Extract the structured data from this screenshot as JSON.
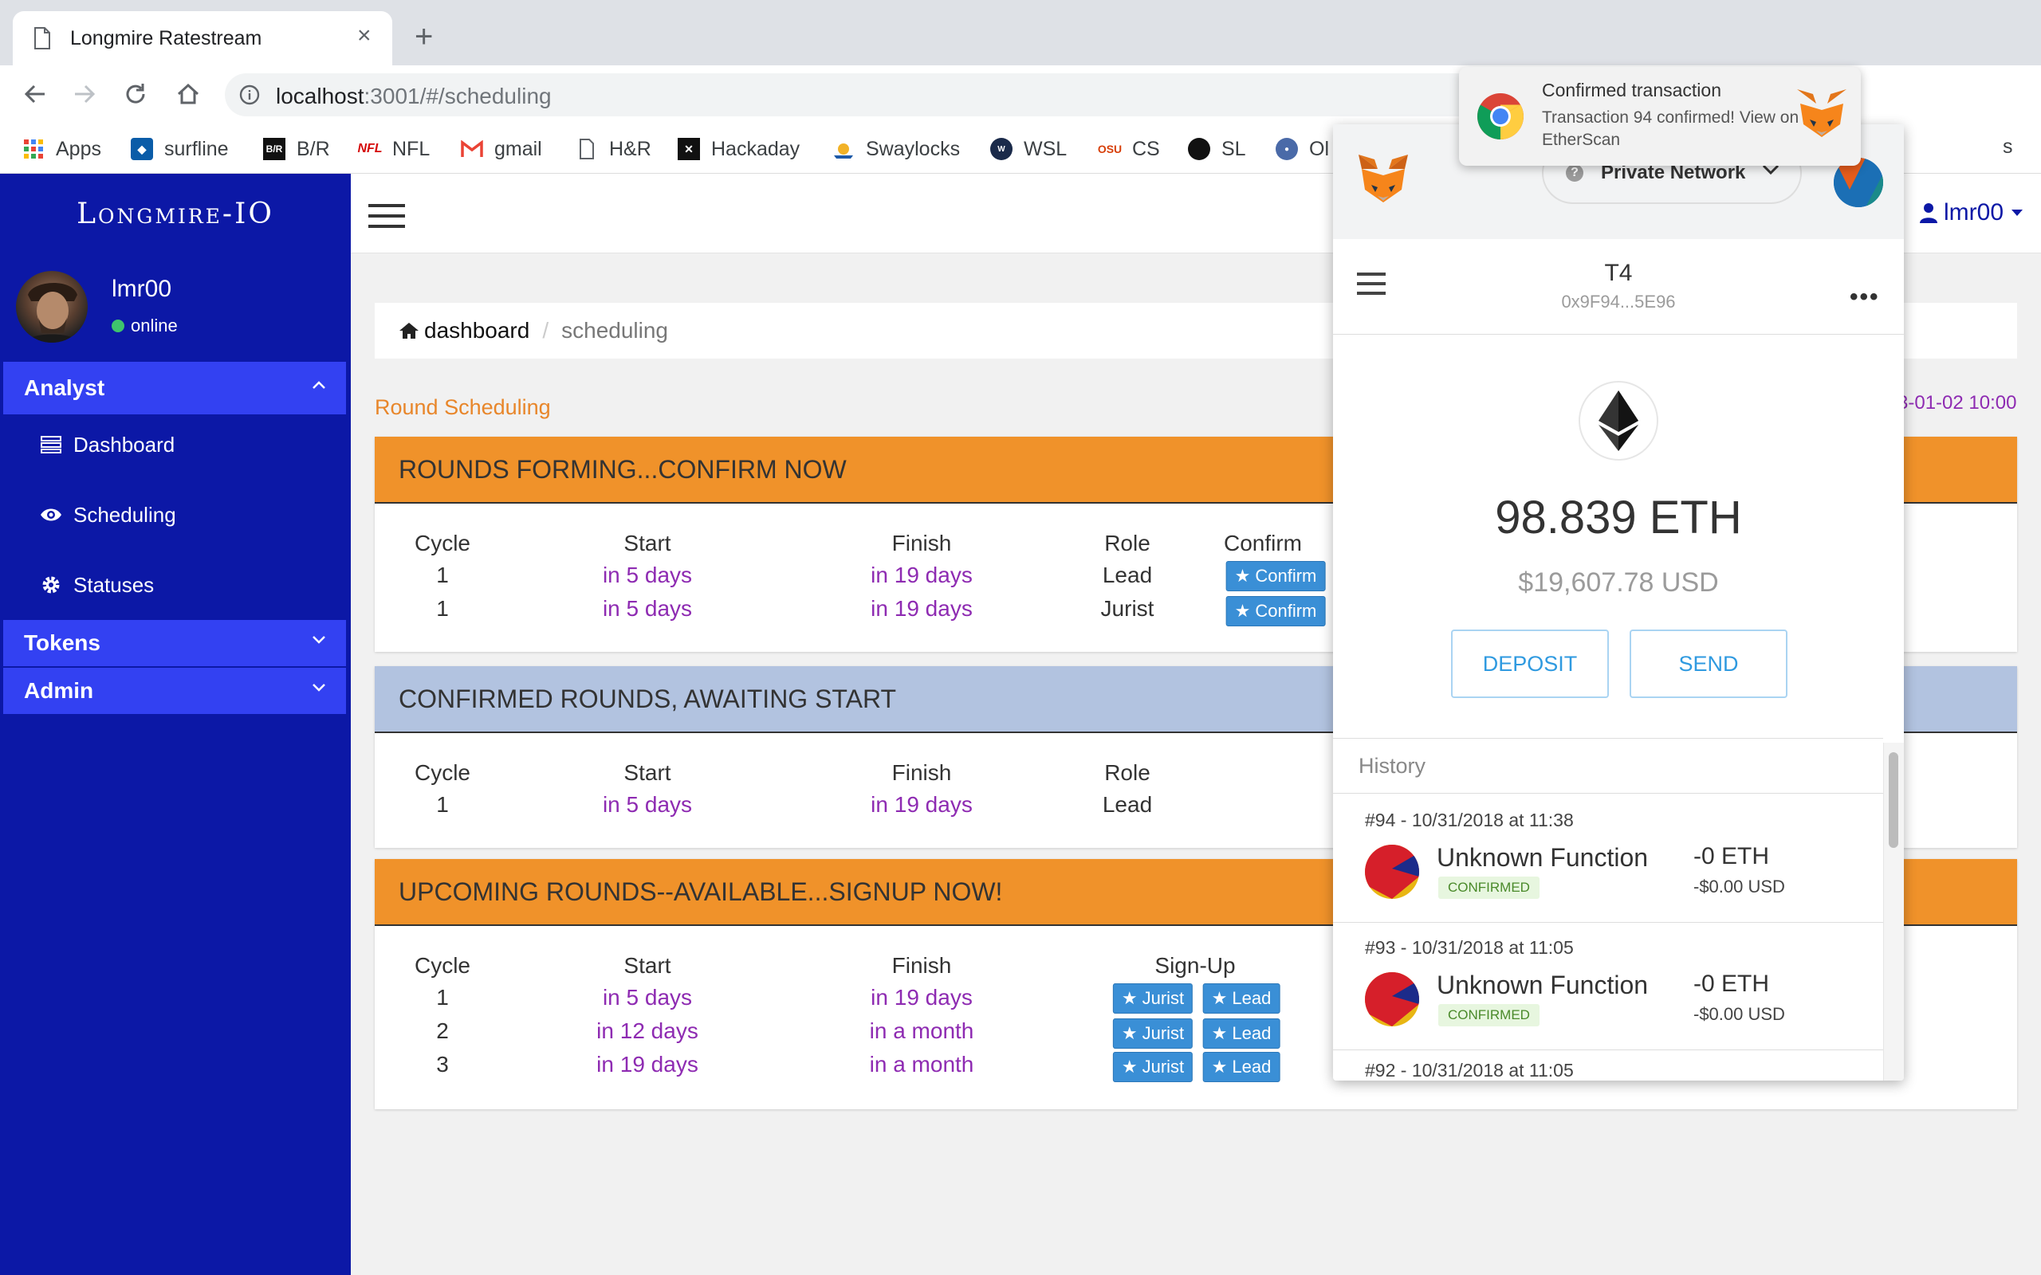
{
  "browser": {
    "tab_title": "Longmire Ratestream",
    "url_host": "localhost",
    "url_rest": ":3001/#/scheduling",
    "bookmarks": [
      {
        "label": "Apps"
      },
      {
        "label": "surfline"
      },
      {
        "label": "B/R"
      },
      {
        "label": "NFL"
      },
      {
        "label": "gmail"
      },
      {
        "label": "H&R"
      },
      {
        "label": "Hackaday"
      },
      {
        "label": "Swaylocks"
      },
      {
        "label": "WSL"
      },
      {
        "label": "CS"
      },
      {
        "label": "SL"
      },
      {
        "label": "Ol"
      }
    ],
    "bookmark_overflow": "s"
  },
  "sidebar": {
    "brand": "Longmire-IO",
    "user": "lmr00",
    "status": "online",
    "sections": [
      {
        "label": "Analyst",
        "items": [
          "Dashboard",
          "Scheduling",
          "Statuses"
        ]
      },
      {
        "label": "Tokens"
      },
      {
        "label": "Admin"
      }
    ]
  },
  "header": {
    "user": "lmr00"
  },
  "breadcrumb": {
    "home": "dashboard",
    "current": "scheduling"
  },
  "page": {
    "title": "Round Scheduling",
    "clock_partial": "3-01-02 10:00"
  },
  "panels": {
    "forming": {
      "title": "ROUNDS FORMING...CONFIRM NOW",
      "headers": [
        "Cycle",
        "Start",
        "Finish",
        "Role",
        "Confirm"
      ],
      "rows": [
        {
          "cycle": "1",
          "start": "in 5 days",
          "finish": "in 19 days",
          "role": "Lead",
          "action": "Confirm"
        },
        {
          "cycle": "1",
          "start": "in 5 days",
          "finish": "in 19 days",
          "role": "Jurist",
          "action": "Confirm"
        }
      ]
    },
    "confirmed": {
      "title": "CONFIRMED ROUNDS, AWAITING START",
      "headers": [
        "Cycle",
        "Start",
        "Finish",
        "Role"
      ],
      "rows": [
        {
          "cycle": "1",
          "start": "in 5 days",
          "finish": "in 19 days",
          "role": "Lead"
        }
      ]
    },
    "upcoming": {
      "title": "UPCOMING ROUNDS--AVAILABLE...SIGNUP NOW!",
      "headers": [
        "Cycle",
        "Start",
        "Finish",
        "Sign-Up"
      ],
      "rows": [
        {
          "cycle": "1",
          "start": "in 5 days",
          "finish": "in 19 days",
          "jurist": "Jurist",
          "lead": "Lead"
        },
        {
          "cycle": "2",
          "start": "in 12 days",
          "finish": "in a month",
          "jurist": "Jurist",
          "lead": "Lead"
        },
        {
          "cycle": "3",
          "start": "in 19 days",
          "finish": "in a month",
          "jurist": "Jurist",
          "lead": "Lead"
        }
      ]
    }
  },
  "metamask": {
    "network": "Private Network",
    "account_name": "T4",
    "account_address": "0x9F94...5E96",
    "balance_eth": "98.839 ETH",
    "balance_usd": "$19,607.78 USD",
    "deposit_label": "DEPOSIT",
    "send_label": "SEND",
    "history_label": "History",
    "transactions": [
      {
        "date": "#94 - 10/31/2018 at 11:38",
        "function": "Unknown Function",
        "status": "CONFIRMED",
        "eth": "-0 ETH",
        "usd": "-$0.00 USD"
      },
      {
        "date": "#93 - 10/31/2018 at 11:05",
        "function": "Unknown Function",
        "status": "CONFIRMED",
        "eth": "-0 ETH",
        "usd": "-$0.00 USD"
      },
      {
        "date": "#92 - 10/31/2018 at 11:05"
      }
    ]
  },
  "notification": {
    "title": "Confirmed transaction",
    "body": "Transaction 94 confirmed! View on EtherScan"
  },
  "colors": {
    "sidebar_bg": "#0c18a6",
    "sidebar_active": "#3341f2",
    "panel_orange": "#f0922a",
    "panel_blue": "#b2c3e0",
    "time_purple": "#8e2bb2",
    "button_blue": "#3a8fd6",
    "title_orange": "#e8862a"
  }
}
